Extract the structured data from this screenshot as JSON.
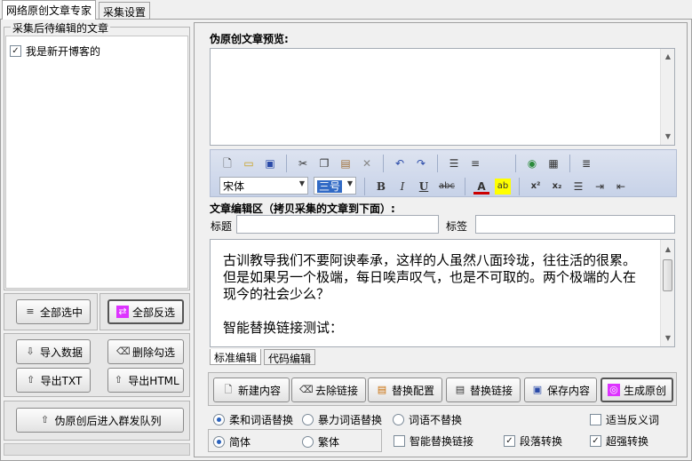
{
  "tabs": [
    "网络原创文章专家",
    "采集设置"
  ],
  "left": {
    "group_title": "采集后待编辑的文章",
    "items": [
      {
        "label": "我是新开博客的",
        "checked": true
      }
    ],
    "buttons": {
      "select_all": "全部选中",
      "invert_all": "全部反选",
      "import": "导入数据",
      "delete_checked": "删除勾选",
      "export_txt": "导出TXT",
      "export_html": "导出HTML",
      "queue": "伪原创后进入群发队列"
    }
  },
  "preview": {
    "title": "伪原创文章预览:"
  },
  "toolbar": {
    "font_name": "宋体",
    "font_size": "三号",
    "row1": [
      "new-doc-icon",
      "open-folder-icon",
      "save-icon",
      "cut-icon",
      "copy-icon",
      "paste-icon",
      "delete-icon",
      "undo-icon",
      "redo-icon",
      "align-justify-icon",
      "align-left-icon",
      "link-globe-icon",
      "table-icon",
      "select-all-icon"
    ],
    "row2": [
      "bold-icon",
      "italic-icon",
      "underline-icon",
      "strikethrough-icon",
      "font-color-icon",
      "highlight-icon",
      "superscript-icon",
      "subscript-icon",
      "numbered-list-icon",
      "indent-icon",
      "outdent-icon"
    ],
    "glyphs": {
      "bold": "B",
      "italic": "I",
      "underline": "U",
      "strike": "abc",
      "superscript": "x²",
      "subscript": "x₂"
    }
  },
  "edit": {
    "section_title": "文章编辑区（拷贝采集的文章到下面）:",
    "title_label": "标题",
    "title_value": "",
    "tags_label": "标签",
    "tags_value": "",
    "content": "古训教导我们不要阿谀奉承，这样的人虽然八面玲珑，往往活的很累。但是如果另一个极端，每日唉声叹气，也是不可取的。两个极端的人在现今的社会少么？\n\n智能替换链接测试：",
    "tabs": [
      "标准编辑",
      "代码编辑"
    ]
  },
  "actions": {
    "new": "新建内容",
    "remove_links": "去除链接",
    "replace_config": "替换配置",
    "replace_links": "替换链接",
    "save": "保存内容",
    "generate": "生成原创"
  },
  "options": {
    "mode": [
      {
        "label": "柔和词语替换",
        "checked": true
      },
      {
        "label": "暴力词语替换",
        "checked": false
      },
      {
        "label": "词语不替换",
        "checked": false
      }
    ],
    "antonym": {
      "label": "适当反义词",
      "checked": false
    },
    "charset": [
      {
        "label": "简体",
        "checked": true
      },
      {
        "label": "繁体",
        "checked": false
      }
    ],
    "smart_link": {
      "label": "智能替换链接",
      "checked": false
    },
    "paragraph": {
      "label": "段落转换",
      "checked": true
    },
    "super": {
      "label": "超强转换",
      "checked": true
    }
  }
}
